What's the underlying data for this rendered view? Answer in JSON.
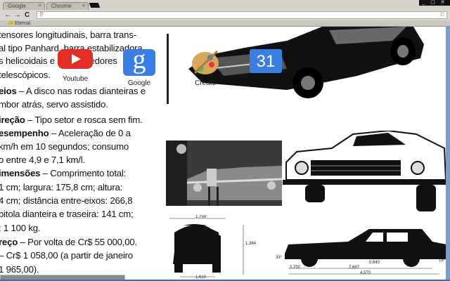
{
  "browser": {
    "tabs": [
      {
        "label": "Google"
      },
      {
        "label": "Chrome"
      }
    ],
    "window_controls": "_ ▢ ✕",
    "nav": {
      "back": "←",
      "forward": "→",
      "reload": "C"
    },
    "omnibox": {
      "value": "",
      "search_icon": "search-icon",
      "star_icon": "star-icon"
    },
    "bookmarks": [
      {
        "label": "Eternal"
      }
    ]
  },
  "apps": [
    {
      "label": "Youtube",
      "icon": "youtube-icon",
      "color": "#e52d27"
    },
    {
      "label": "Google",
      "icon": "google-search-icon",
      "color": "#3a7ee3",
      "glyph": "g"
    },
    {
      "label": "Create",
      "icon": "paint-palette-icon"
    },
    {
      "label": "",
      "icon": "calendar-icon",
      "color": "#3a7ee3",
      "glyph": "31"
    }
  ],
  "article": {
    "lines": [
      {
        "b": "",
        "t": "tensores longitudinais, barra trans-"
      },
      {
        "b": "",
        "t": "al tipo Panhard, barra estabilizadora,"
      },
      {
        "b": "",
        "t": "s helicoidais e amortecedores"
      },
      {
        "b": "",
        "t": " telescópicos."
      },
      {
        "b": "eios",
        "t": " – A disco nas rodas dianteiras e"
      },
      {
        "b": "",
        "t": "mbor atrás, servo assistido."
      },
      {
        "b": "ireção",
        "t": " – Tipo setor e rosca sem fim."
      },
      {
        "b": "esempenho",
        "t": " – Aceleração de 0 a"
      },
      {
        "b": "",
        "t": " km/h em 10 segundos; consumo"
      },
      {
        "b": "",
        "t": "o entre 4,9 e 7,1 km/l."
      },
      {
        "b": "imensões",
        "t": " – Comprimento total:"
      },
      {
        "b": "",
        "t": "1 cm; largura: 175,8 cm; altura:"
      },
      {
        "b": "",
        "t": "4 cm; distância entre-eixos: 266,8"
      },
      {
        "b": "",
        "t": "bitola dianteira e traseira: 141 cm;"
      },
      {
        "b": "",
        "t": ": 1 100 kg."
      },
      {
        "b": "reço",
        "t": " – Por volta de Cr$ 55 000,00."
      },
      {
        "b": "",
        "t": " – Cr$ 1 058,00 (a partir de janeiro"
      },
      {
        "b": "",
        "t": "1 965,00)."
      }
    ]
  },
  "blueprint": {
    "front_width": "1,758",
    "front_height": "1,384",
    "front_track": "1,610",
    "angle_front": "33°",
    "angle_rear": "18°",
    "overhang": "0,700",
    "wheelbase": "2,667",
    "clearance": "0,640",
    "length": "4,570"
  }
}
